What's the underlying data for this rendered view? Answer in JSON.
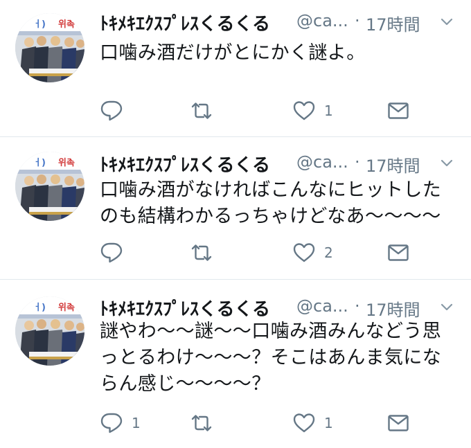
{
  "tweets": [
    {
      "name": "ﾄｷﾒｷｴｸｽﾌﾟﾚｽくるくる",
      "handle": "@ca...",
      "separator": "·",
      "time": "17時間",
      "lines": [
        "口噛み酒だけがとにかく謎よ。"
      ],
      "counts": {
        "reply": "",
        "retweet": "",
        "like": "1"
      }
    },
    {
      "name": "ﾄｷﾒｷｴｸｽﾌﾟﾚｽくるくる",
      "handle": "@ca...",
      "separator": "·",
      "time": "17時間",
      "lines": [
        "口噛み酒がなければこんなにヒットした",
        "のも結構わかるっちゃけどなあ〜〜〜〜"
      ],
      "counts": {
        "reply": "",
        "retweet": "",
        "like": "2"
      }
    },
    {
      "name": "ﾄｷﾒｷｴｸｽﾌﾟﾚｽくるくる",
      "handle": "@ca...",
      "separator": "·",
      "time": "17時間",
      "lines": [
        "謎やわ〜〜謎〜〜口噛み酒みんなどう思",
        "っとるわけ〜〜〜？そこはあんま気にな",
        "らん感じ〜〜〜〜？"
      ],
      "counts": {
        "reply": "1",
        "retweet": "",
        "like": "1"
      }
    }
  ],
  "icons": {
    "reply": "reply-icon",
    "retweet": "retweet-icon",
    "like": "heart-icon",
    "message": "envelope-icon",
    "more": "chevron-down-icon"
  },
  "colors": {
    "text": "#14171a",
    "muted": "#657786",
    "divider": "#e1e8ed"
  }
}
